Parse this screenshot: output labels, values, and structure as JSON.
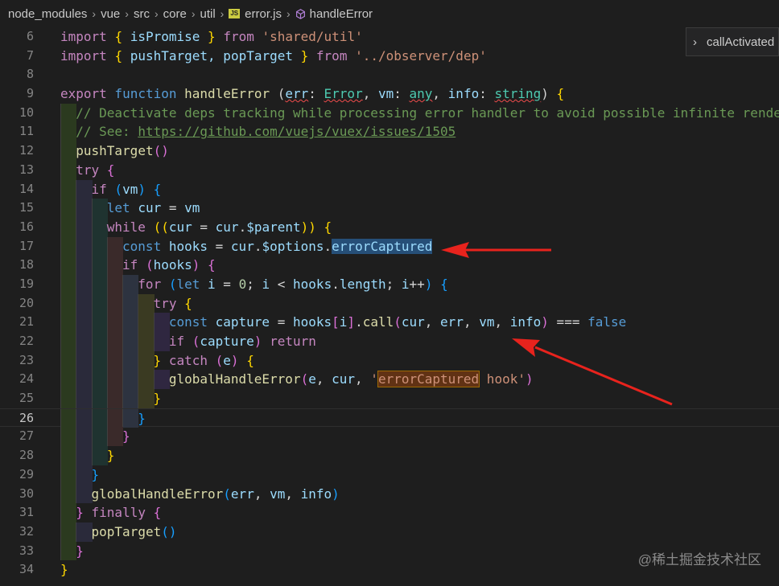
{
  "breadcrumb": {
    "items": [
      "node_modules",
      "vue",
      "src",
      "core",
      "util"
    ],
    "file": "error.js",
    "file_badge": "JS",
    "symbol": "handleError"
  },
  "peek": {
    "label": "callActivated"
  },
  "watermark": "@稀土掘金技术社区",
  "active_line": 26,
  "lines": [
    {
      "n": "6"
    },
    {
      "n": "7"
    },
    {
      "n": "8"
    },
    {
      "n": "9"
    },
    {
      "n": "10"
    },
    {
      "n": "11"
    },
    {
      "n": "12"
    },
    {
      "n": "13"
    },
    {
      "n": "14"
    },
    {
      "n": "15"
    },
    {
      "n": "16"
    },
    {
      "n": "17"
    },
    {
      "n": "18"
    },
    {
      "n": "19"
    },
    {
      "n": "20"
    },
    {
      "n": "21"
    },
    {
      "n": "22"
    },
    {
      "n": "23"
    },
    {
      "n": "24"
    },
    {
      "n": "25"
    },
    {
      "n": "26"
    },
    {
      "n": "27"
    },
    {
      "n": "28"
    },
    {
      "n": "29"
    },
    {
      "n": "30"
    },
    {
      "n": "31"
    },
    {
      "n": "32"
    },
    {
      "n": "33"
    },
    {
      "n": "34"
    }
  ],
  "code": {
    "l6": [
      "import",
      " ",
      "{",
      " isPromise ",
      "}",
      " from ",
      "'shared/util'"
    ],
    "l7": [
      "import",
      " ",
      "{",
      " pushTarget, popTarget ",
      "}",
      " from ",
      "'../observer/dep'"
    ],
    "l9": [
      "export",
      " function ",
      "handleError",
      " (",
      "err",
      ": ",
      "Error",
      ", ",
      "vm",
      ": ",
      "any",
      ", ",
      "info",
      ": ",
      "string",
      ") ",
      "{"
    ],
    "l10": "// Deactivate deps tracking while processing error handler to avoid possible infinite rendering.",
    "l11_prefix": "// See: ",
    "l11_link": "https://github.com/vuejs/vuex/issues/1505",
    "l12": [
      "pushTarget",
      "()"
    ],
    "l13": [
      "try",
      " ",
      "{"
    ],
    "l14": [
      "if",
      " ",
      "(",
      "vm",
      ")",
      " ",
      "{"
    ],
    "l15": [
      "let",
      " ",
      "cur",
      " = ",
      "vm"
    ],
    "l16": [
      "while",
      " ",
      "((",
      "cur",
      " = ",
      "cur",
      ".",
      "$parent",
      "))",
      " ",
      "{"
    ],
    "l17": [
      "const",
      " ",
      "hooks",
      " = ",
      "cur",
      ".",
      "$options",
      ".",
      "errorCaptured"
    ],
    "l18": [
      "if",
      " ",
      "(",
      "hooks",
      ")",
      " ",
      "{"
    ],
    "l19": [
      "for",
      " ",
      "(",
      "let",
      " ",
      "i",
      " = ",
      "0",
      "; ",
      "i",
      " < ",
      "hooks",
      ".",
      "length",
      "; ",
      "i",
      "++",
      ")",
      " ",
      "{"
    ],
    "l20": [
      "try",
      " ",
      "{"
    ],
    "l21": [
      "const",
      " ",
      "capture",
      " = ",
      "hooks",
      "[",
      "i",
      "]",
      ".",
      "call",
      "(",
      "cur",
      ", ",
      "err",
      ", ",
      "vm",
      ", ",
      "info",
      ")",
      " === ",
      "false"
    ],
    "l22": [
      "if",
      " ",
      "(",
      "capture",
      ")",
      " ",
      "return"
    ],
    "l23": [
      "}",
      " ",
      "catch",
      " ",
      "(",
      "e",
      ")",
      " ",
      "{"
    ],
    "l24": [
      "globalHandleError",
      "(",
      "e",
      ", ",
      "cur",
      ", ",
      "'",
      "errorCaptured",
      " hook'",
      ")"
    ],
    "l25": [
      "}"
    ],
    "l26": [
      "}"
    ],
    "l27": [
      "}"
    ],
    "l28": [
      "}"
    ],
    "l29": [
      "}"
    ],
    "l30": [
      "globalHandleError",
      "(",
      "err",
      ", ",
      "vm",
      ", ",
      "info",
      ")"
    ],
    "l31": [
      "}",
      " ",
      "finally",
      " ",
      "{"
    ],
    "l32": [
      "popTarget",
      "()"
    ],
    "l33": [
      "}"
    ],
    "l34": [
      "}"
    ]
  },
  "colors": {
    "background": "#1e1e1e",
    "keyword": "#569cd6",
    "control": "#c586c0",
    "function": "#dcdcaa",
    "variable": "#9cdcfe",
    "string": "#ce9178",
    "comment": "#6a9955",
    "annotation_arrow": "#e8231d"
  }
}
